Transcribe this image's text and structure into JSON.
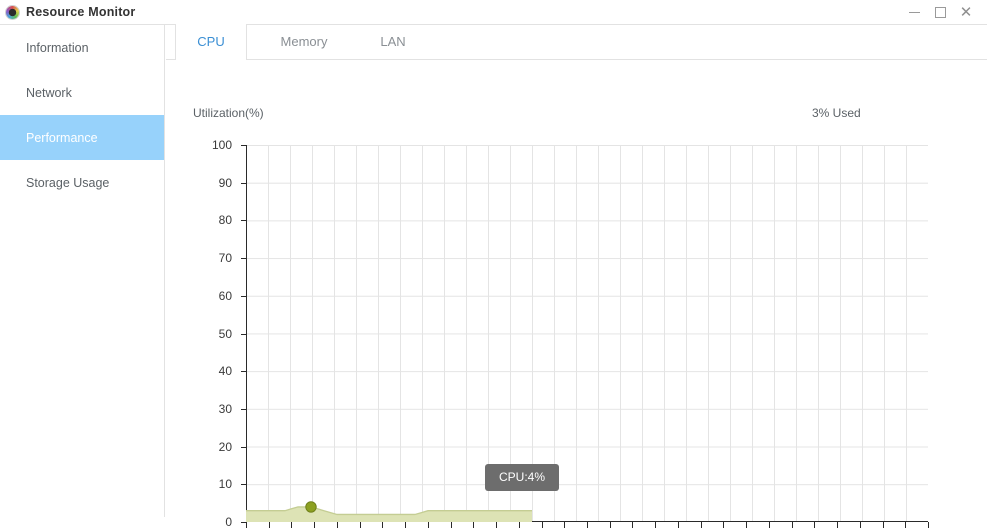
{
  "window": {
    "title": "Resource Monitor",
    "icon": "app-color-wheel-icon",
    "controls": {
      "minimize": "minimize-icon",
      "maximize": "maximize-icon",
      "close": "close-icon"
    }
  },
  "sidebar": {
    "items": [
      {
        "label": "Information",
        "selected": false
      },
      {
        "label": "Network",
        "selected": false
      },
      {
        "label": "Performance",
        "selected": true
      },
      {
        "label": "Storage Usage",
        "selected": false
      }
    ]
  },
  "tabs": [
    {
      "label": "CPU",
      "active": true
    },
    {
      "label": "Memory",
      "active": false
    },
    {
      "label": "LAN",
      "active": false
    }
  ],
  "panel": {
    "axis_title": "Utilization(%)",
    "used_label": "3% Used",
    "tooltip": "CPU:4%"
  },
  "colors": {
    "accent": "#3b8fd4",
    "sidebar_selected": "#97d2fb",
    "series_fill": "#dde3b5",
    "series_stroke": "#c4cd93",
    "marker": "#8ca021",
    "tooltip_bg": "#6d6d6d",
    "grid": "#e4e4e4",
    "axis": "#2a2a2a"
  },
  "chart_data": {
    "type": "area",
    "title": "Utilization(%)",
    "xlabel": "",
    "ylabel": "Utilization(%)",
    "ylim": [
      0,
      100
    ],
    "yticks": [
      0,
      10,
      20,
      30,
      40,
      50,
      60,
      70,
      80,
      90,
      100
    ],
    "ytick_labels": [
      "0",
      "10",
      "20",
      "30",
      "40",
      "50",
      "60",
      "70",
      "80",
      "90",
      "100"
    ],
    "xticks_count": 31,
    "xtick_labels": [],
    "grid": true,
    "legend": false,
    "series": [
      {
        "name": "CPU",
        "unit": "%",
        "values": [
          3,
          3,
          3,
          3,
          4,
          4,
          3,
          2,
          2,
          2,
          2,
          2,
          2,
          2,
          3,
          3,
          3,
          3,
          3,
          3,
          3,
          3,
          3
        ]
      }
    ],
    "annotations": [
      {
        "type": "marker",
        "series": "CPU",
        "index": 5,
        "value": 4,
        "label": "CPU:4%"
      }
    ]
  }
}
